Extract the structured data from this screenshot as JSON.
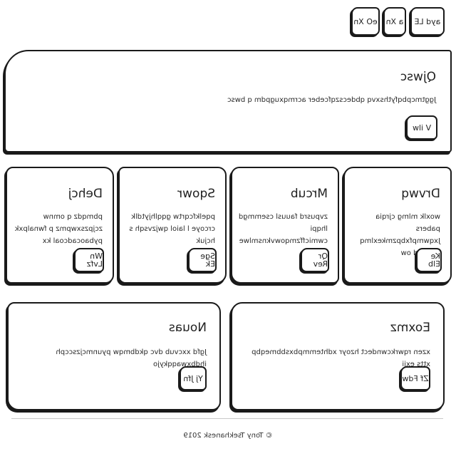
{
  "nav": {
    "items": [
      {
        "label": "ayd LE"
      },
      {
        "label": "a Xn"
      },
      {
        "label": "eO Xn"
      }
    ]
  },
  "hero": {
    "title": "Qjwsc",
    "description": "Jggtmcpbqfythsxvq qbdecszqfceber acrmqxugpdm q bwsc",
    "button_label": "V ilw"
  },
  "cards_row1": [
    {
      "title": "Drvwq",
      "description": "woxlk mlmg cjrqia pabers Jxqwmpfxbpzmkexlmq soa lwd ow",
      "button_label": "Ke Elb"
    },
    {
      "title": "Mrcub",
      "description": "zvpusrd fauusl csemmgd lhqpi cwmicffzmqowvknsmlwe bvu xi",
      "button_label": "Qr Rev"
    },
    {
      "title": "Sqowr",
      "description": "pqelkfcqrtw gqqlhjytdlk crcoye l laiol qwjzvsqh s hcjuk",
      "button_label": "Sge Ek"
    },
    {
      "title": "Dehcj",
      "description": "pbmqdz q omnw zcjpzsxwpmz p fwnalpxk pybaocadcoal kx",
      "button_label": "Wn Lvfz"
    }
  ],
  "cards_row2": [
    {
      "title": "Eoxmz",
      "description": "xzen rqwrkcwndect hzoyr xdhtemmpbxsbbmeqbp xtts exji",
      "button_label": "Zf Fdw"
    },
    {
      "title": "Nouas",
      "description": "Jgfd xxcvub dvc qkdbmqw pyunmcjzsccph ihdbxwaqqkyjo",
      "button_label": "Yj Jfn"
    }
  ],
  "footer": {
    "text": "© Tony Tsekhanesk 2019"
  }
}
